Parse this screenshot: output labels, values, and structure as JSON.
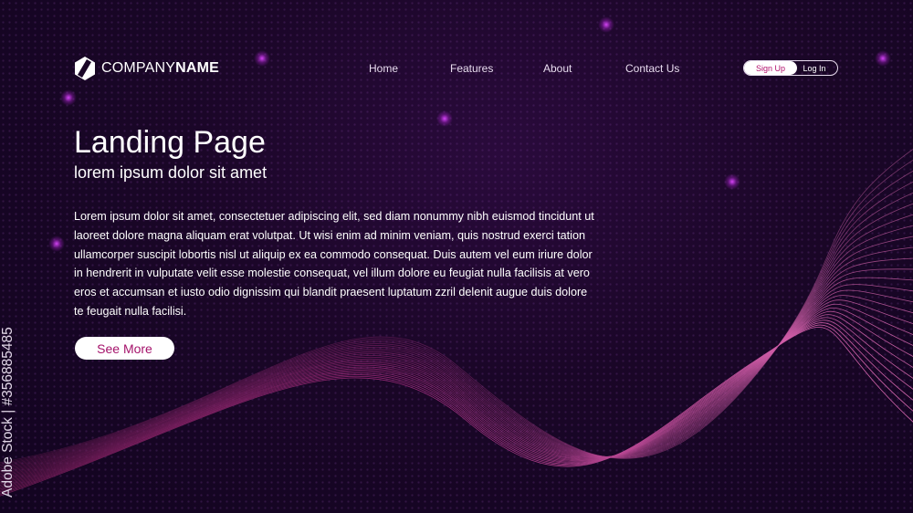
{
  "header": {
    "logo": {
      "text_light": "COMPANY",
      "text_bold": "NAME"
    },
    "nav": [
      {
        "label": "Home"
      },
      {
        "label": "Features"
      },
      {
        "label": "About"
      },
      {
        "label": "Contact Us"
      }
    ],
    "auth": {
      "signup_label": "Sign Up",
      "login_label": "Log In"
    }
  },
  "hero": {
    "title": "Landing Page",
    "subtitle": "lorem ipsum dolor sit amet",
    "body": "Lorem ipsum dolor sit amet, consectetuer adipiscing elit, sed diam nonummy nibh euismod tincidunt ut laoreet dolore magna aliquam erat volutpat. Ut wisi enim ad minim veniam, quis nostrud exerci tation ullamcorper suscipit lobortis nisl ut aliquip ex ea commodo consequat. Duis autem vel eum iriure dolor in hendrerit in vulputate velit esse molestie consequat, vel illum dolore eu feugiat nulla facilisis at vero eros et accumsan et iusto odio dignissim qui blandit praesent luptatum zzril delenit augue duis dolore te feugait nulla facilisi.",
    "cta_label": "See More"
  },
  "watermark": {
    "text": "Adobe Stock | #356885485"
  },
  "colors": {
    "background": "#1a0627",
    "accent": "#b2106c",
    "wave_light": "#e26fb8",
    "wave_dark": "#7a1d5c"
  }
}
